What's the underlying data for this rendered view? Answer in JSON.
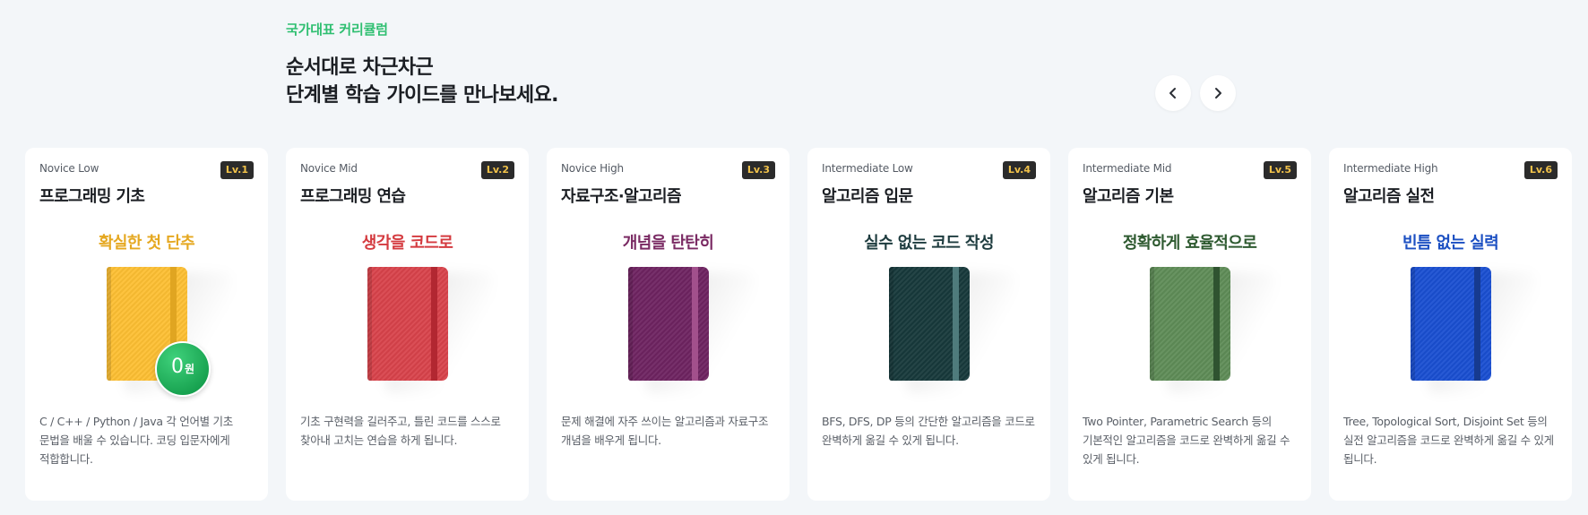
{
  "header": {
    "eyebrow": "국가대표 커리큘럼",
    "title_line1": "순서대로 차근차근",
    "title_line2": "단계별 학습 가이드를 만나보세요."
  },
  "nav": {
    "prev_icon": "chevron-left-icon",
    "next_icon": "chevron-right-icon"
  },
  "cards": [
    {
      "level_tag": "Novice Low",
      "badge": "Lv.1",
      "title": "프로그래밍 기초",
      "tagline": "확실한 첫 단추",
      "tagline_color": "#e5a821",
      "book_color": "#fdbf33",
      "strap_color": "#e0a521",
      "free_badge": {
        "number": "0",
        "unit": "원"
      },
      "description": "C / C++ / Python / Java 각 언어별 기초 문법을 배울 수 있습니다. 코딩 입문자에게 적합합니다."
    },
    {
      "level_tag": "Novice Mid",
      "badge": "Lv.2",
      "title": "프로그래밍 연습",
      "tagline": "생각을 코드로",
      "tagline_color": "#d43a3f",
      "book_color": "#d8434b",
      "strap_color": "#b22731",
      "description": "기초 구현력을 길러주고, 틀린 코드를 스스로 찾아내 고치는 연습을 하게 됩니다."
    },
    {
      "level_tag": "Novice High",
      "badge": "Lv.3",
      "title": "자료구조·알고리즘",
      "tagline": "개념을 탄탄히",
      "tagline_color": "#7a2a63",
      "book_color": "#6e2361",
      "strap_color": "#a2508c",
      "description": "문제 해결에 자주 쓰이는 알고리즘과 자료구조 개념을 배우게 됩니다."
    },
    {
      "level_tag": "Intermediate Low",
      "badge": "Lv.4",
      "title": "알고리즘 입문",
      "tagline": "실수 없는 코드 작성",
      "tagline_color": "#1e3c3f",
      "book_color": "#17393b",
      "strap_color": "#4f7b7c",
      "description": "BFS, DFS, DP 등의 간단한 알고리즘을 코드로 완벽하게 옮길 수 있게 됩니다."
    },
    {
      "level_tag": "Intermediate Mid",
      "badge": "Lv.5",
      "title": "알고리즘 기본",
      "tagline": "정확하게 효율적으로",
      "tagline_color": "#2e5a30",
      "book_color": "#5f8c57",
      "strap_color": "#2f5330",
      "description": "Two Pointer, Parametric Search 등의 기본적인 알고리즘을 코드로 완벽하게 옮길 수 있게 됩니다."
    },
    {
      "level_tag": "Intermediate High",
      "badge": "Lv.6",
      "title": "알고리즘 실전",
      "tagline": "빈틈 없는 실력",
      "tagline_color": "#1b4fc2",
      "book_color": "#1a4fd1",
      "strap_color": "#163a8f",
      "description": "Tree, Topological Sort, Disjoint Set 등의 실전 알고리즘을 코드로 완벽하게 옮길 수 있게 됩니다."
    }
  ]
}
